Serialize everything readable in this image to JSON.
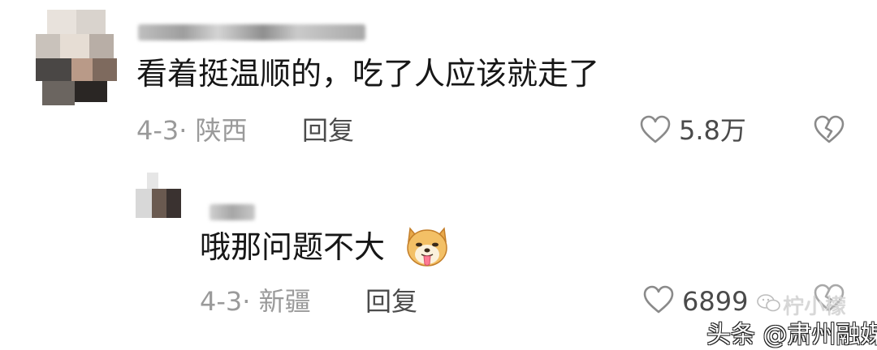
{
  "comments": [
    {
      "text": "看着挺温顺的，吃了人应该就走了",
      "meta": "4-3· 陕西",
      "reply_label": "回复",
      "like_count": "5.8万",
      "like_icon": "heart-outline-icon",
      "dislike_icon": "broken-heart-icon"
    },
    {
      "text": "哦那问题不大",
      "emoji": "doge-tongue-emoji",
      "meta": "4-3· 新疆",
      "reply_label": "回复",
      "like_count": "6899",
      "like_icon": "heart-outline-icon",
      "dislike_icon": "broken-heart-icon"
    }
  ],
  "watermarks": {
    "overlay": "柠小檬",
    "source": "头条 @肃州融媒"
  }
}
